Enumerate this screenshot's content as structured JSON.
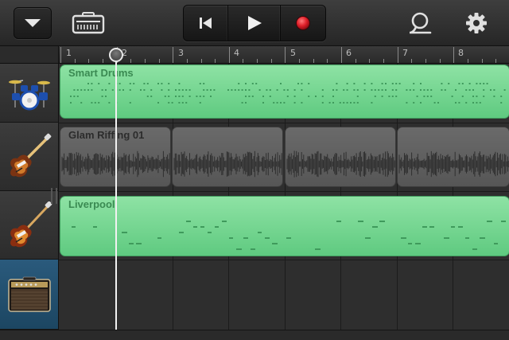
{
  "toolbar": {
    "icons": {
      "menu": "chevron-down-icon",
      "instrument": "amp-icon",
      "rewind": "skip-to-start-icon",
      "play": "play-icon",
      "record": "record-icon",
      "loop": "loop-browser-icon",
      "settings": "gear-icon"
    },
    "record_color": "#e0202a"
  },
  "ruler": {
    "bars": [
      "1",
      "2",
      "3",
      "4",
      "5",
      "6",
      "7",
      "8"
    ]
  },
  "tracks": [
    {
      "instrument_icon": "drum-kit-icon",
      "selected": false
    },
    {
      "instrument_icon": "electric-guitar-icon",
      "selected": false
    },
    {
      "instrument_icon": "bass-guitar-icon",
      "selected": false
    },
    {
      "instrument_icon": "guitar-amp-icon",
      "selected": true
    }
  ],
  "regions": [
    {
      "label": "Smart Drums",
      "type": "midi",
      "color": "#6fd08e"
    },
    {
      "label": "Glam Riffing 01",
      "type": "audio",
      "color": "#5e5e5e"
    },
    {
      "label": "Liverpool",
      "type": "midi",
      "color": "#6fd08e"
    }
  ],
  "colors": {
    "midi_region": "#6fd08e",
    "audio_region": "#5e5e5e",
    "selected_track": "#24506f",
    "playhead": "#f2f2f2"
  }
}
